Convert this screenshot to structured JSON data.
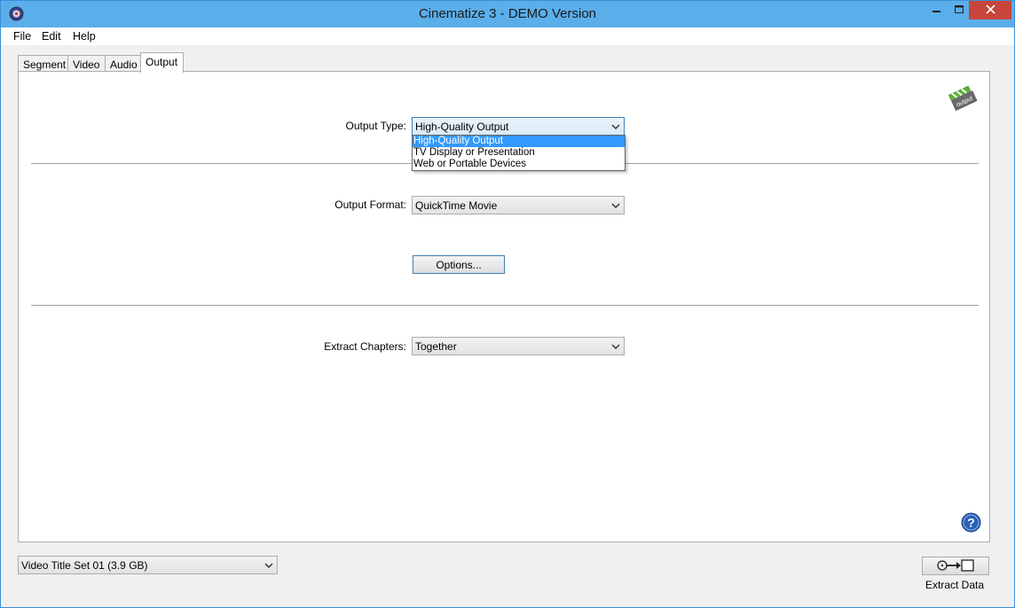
{
  "window": {
    "title": "Cinematize 3 - DEMO Version"
  },
  "menu": {
    "items": [
      "File",
      "Edit",
      "Help"
    ]
  },
  "tabs": {
    "items": [
      "Segment",
      "Video",
      "Audio",
      "Output"
    ],
    "active": "Output"
  },
  "output": {
    "type_label": "Output Type:",
    "type_value": "High-Quality Output",
    "type_options": [
      "High-Quality Output",
      "TV Display or Presentation",
      "Web or Portable Devices"
    ],
    "format_label": "Output Format:",
    "format_value": "QuickTime Movie",
    "options_button": "Options...",
    "chapters_label": "Extract Chapters:",
    "chapters_value": "Together",
    "badge_text": "output"
  },
  "footer": {
    "title_set_value": "Video Title Set 01 (3.9 GB)",
    "extract_label": "Extract Data"
  },
  "colors": {
    "titlebar": "#5aaeea",
    "close_button": "#c7453a",
    "selection": "#3399ff",
    "focus_border": "#3c7fb1"
  }
}
